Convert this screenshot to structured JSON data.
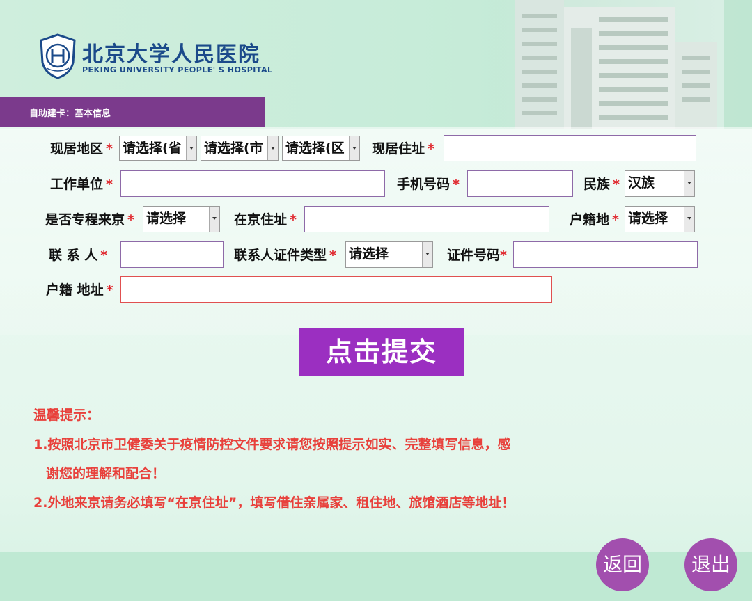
{
  "header": {
    "hospital_name_cn": "北京大学人民医院",
    "hospital_name_en": "PEKING UNIVERSITY PEOPLE' S HOSPITAL",
    "section_title": "自助建卡：基本信息"
  },
  "form": {
    "required_mark": "*",
    "current_region_label": "现居地区",
    "province_select": "请选择(省",
    "city_select": "请选择(市",
    "district_select": "请选择(区",
    "current_address_label": "现居住址",
    "work_unit_label": "工作单位",
    "mobile_label": "手机号码",
    "ethnicity_label": "民族",
    "ethnicity_value": "汉族",
    "dedicated_trip_label": "是否专程来京",
    "dedicated_trip_value": "请选择",
    "beijing_address_label": "在京住址",
    "household_label": "户籍地",
    "household_value": "请选择",
    "contact_label": "联 系 人",
    "contact_id_type_label": "联系人证件类型",
    "contact_id_type_value": "请选择",
    "id_number_label": "证件号码",
    "household_address_label": "户籍 地址"
  },
  "submit_label": "点击提交",
  "tips": {
    "title": "温馨提示：",
    "line1a": "1.按照北京市卫健委关于疫情防控文件要求请您按照提示如实、完整填写信息，感",
    "line1b": "谢您的理解和配合！",
    "line2": "2.外地来京请务必填写“在京住址”，填写借住亲属家、租住地、旅馆酒店等地址！"
  },
  "footer": {
    "back_label": "返回",
    "exit_label": "退出"
  },
  "colors": {
    "accent_purple": "#7b3a8c",
    "submit_purple": "#9b2fc1",
    "round_button": "#a24fae",
    "required_red": "#e0252b",
    "tip_red": "#e8413c",
    "logo_blue": "#1b4a8a"
  }
}
